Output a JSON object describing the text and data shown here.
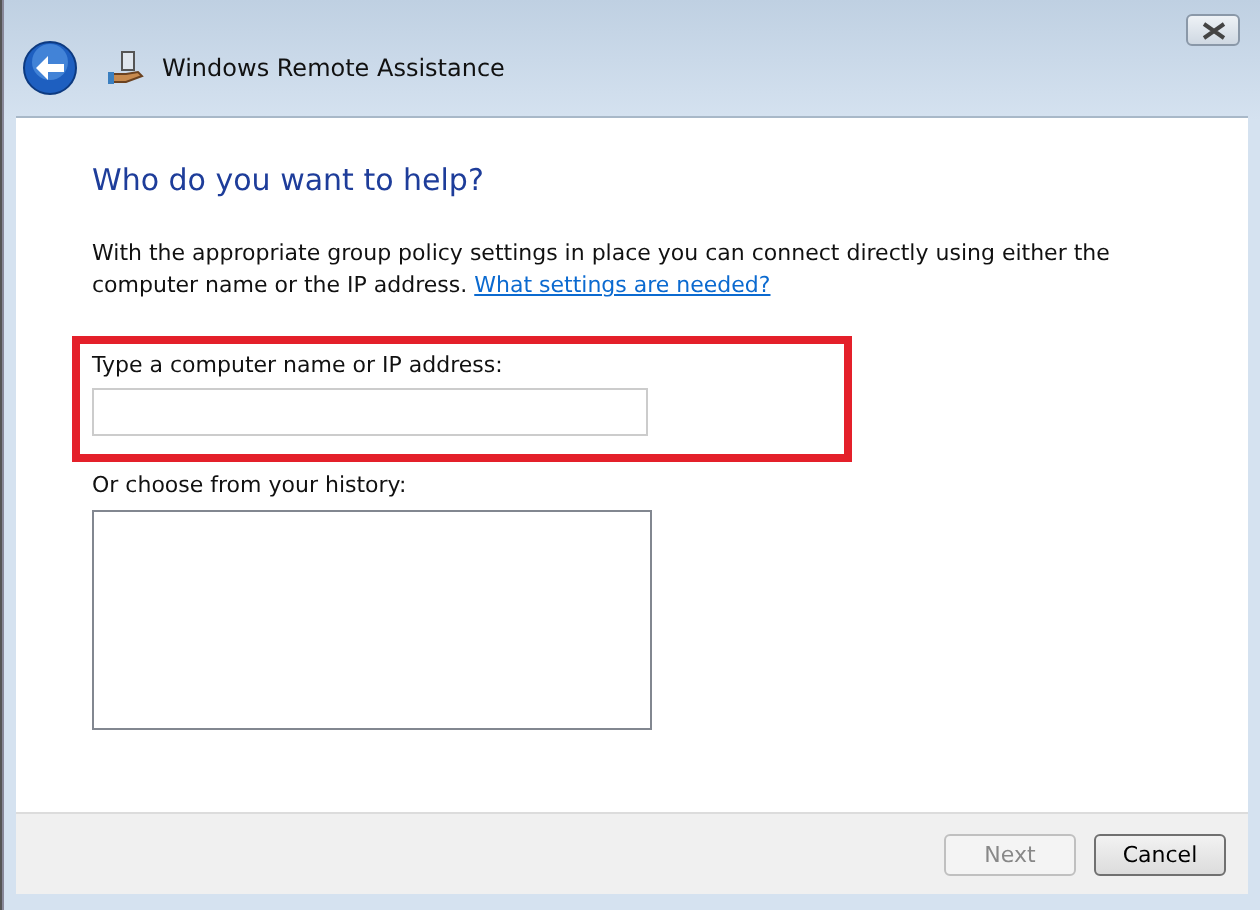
{
  "window": {
    "title": "Windows Remote Assistance"
  },
  "heading": "Who do you want to help?",
  "intro": {
    "text": "With the appropriate group policy settings in place you can connect directly using either the computer name or the IP address.",
    "link": "What settings are needed?"
  },
  "address_field": {
    "label": "Type a computer name or IP address:",
    "highlighted": true
  },
  "history": {
    "label": "Or choose from your history:"
  },
  "buttons": [
    {
      "label": "Next",
      "disabled": true
    },
    {
      "label": "Cancel",
      "disabled": false
    }
  ]
}
